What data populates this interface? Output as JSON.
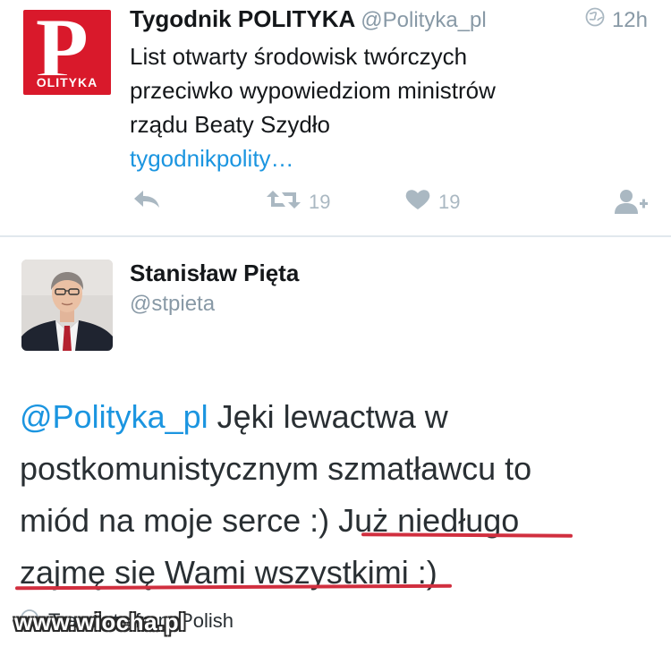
{
  "tweet1": {
    "logo_text": "OLITYKA",
    "display_name": "Tygodnik POLITYKA",
    "handle": "@Polityka_pl",
    "time": "12h",
    "body_lines": [
      "List otwarty środowisk twórczych",
      "przeciwko wypowiedziom ministrów",
      "rządu Beaty Szydło"
    ],
    "link": "tygodnikpolity…",
    "retweet_count": "19",
    "like_count": "19",
    "icons": {
      "globe": "globe-icon",
      "reply": "reply-icon",
      "retweet": "retweet-icon",
      "like": "heart-icon",
      "follow": "follow-icon"
    }
  },
  "tweet2": {
    "display_name": "Stanisław Pięta",
    "handle": "@stpieta",
    "mention": "@Polityka_pl",
    "line1_rest": " Jęki lewactwa w",
    "line2": "postkomunistycznym szmatławcu to",
    "line3": "miód na moje serce :) Już niedługo",
    "line4": "zajmę się Wami wszystkimi :)",
    "translate_label": "Translate from Polish",
    "underline_color": "#d12f3f"
  },
  "watermark": "www.wiocha.pl",
  "colors": {
    "accent": "#1b95e0",
    "muted": "#8899a6",
    "brand_red": "#d9192b"
  }
}
